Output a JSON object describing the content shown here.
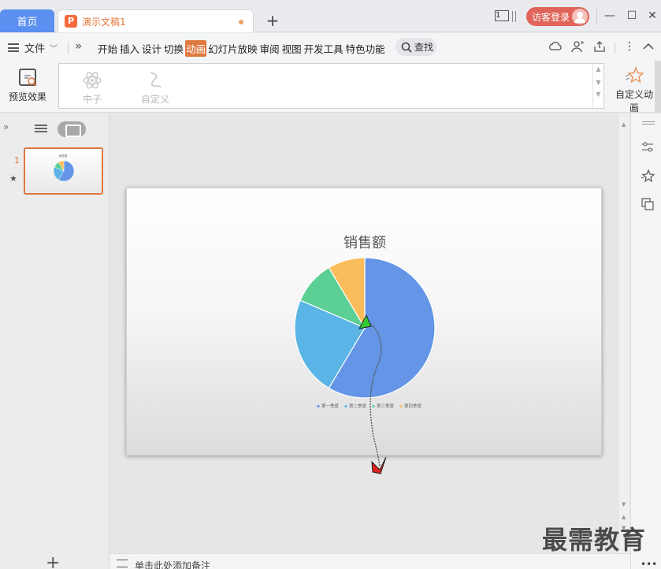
{
  "titlebar": {
    "home_tab": "首页",
    "doc_tab": "演示文稿1",
    "doc_icon": "P",
    "window_count": "1",
    "login": "访客登录"
  },
  "menubar": {
    "file": "文件",
    "tabs": [
      "开始",
      "插入",
      "设计",
      "切换",
      "动画",
      "幻灯片放映",
      "审阅",
      "视图",
      "开发工具",
      "特色功能"
    ],
    "active_tab": "动画",
    "search": "查找"
  },
  "toolbar": {
    "preview": "预览效果",
    "gallery": [
      {
        "label": "中子",
        "icon": "atom-icon"
      },
      {
        "label": "自定义",
        "icon": "custom-path-icon"
      }
    ],
    "custom_anim": "自定义动画"
  },
  "leftpane": {
    "slide_number": "1"
  },
  "slide": {
    "title": "销售额"
  },
  "chart_data": {
    "type": "pie",
    "title": "销售额",
    "categories": [
      "第一季度",
      "第二季度",
      "第三季度",
      "第四季度"
    ],
    "values": [
      8.2,
      3.2,
      1.4,
      1.2
    ],
    "colors": [
      "#6495e6",
      "#5ab4e5",
      "#5ccf94",
      "#fbbd5b"
    ],
    "legend_position": "bottom"
  },
  "motion_path": {
    "start_color": "#33cc33",
    "end_color": "#dd2222"
  },
  "notes": {
    "placeholder": "单击此处添加备注"
  },
  "watermark": "最需教育"
}
